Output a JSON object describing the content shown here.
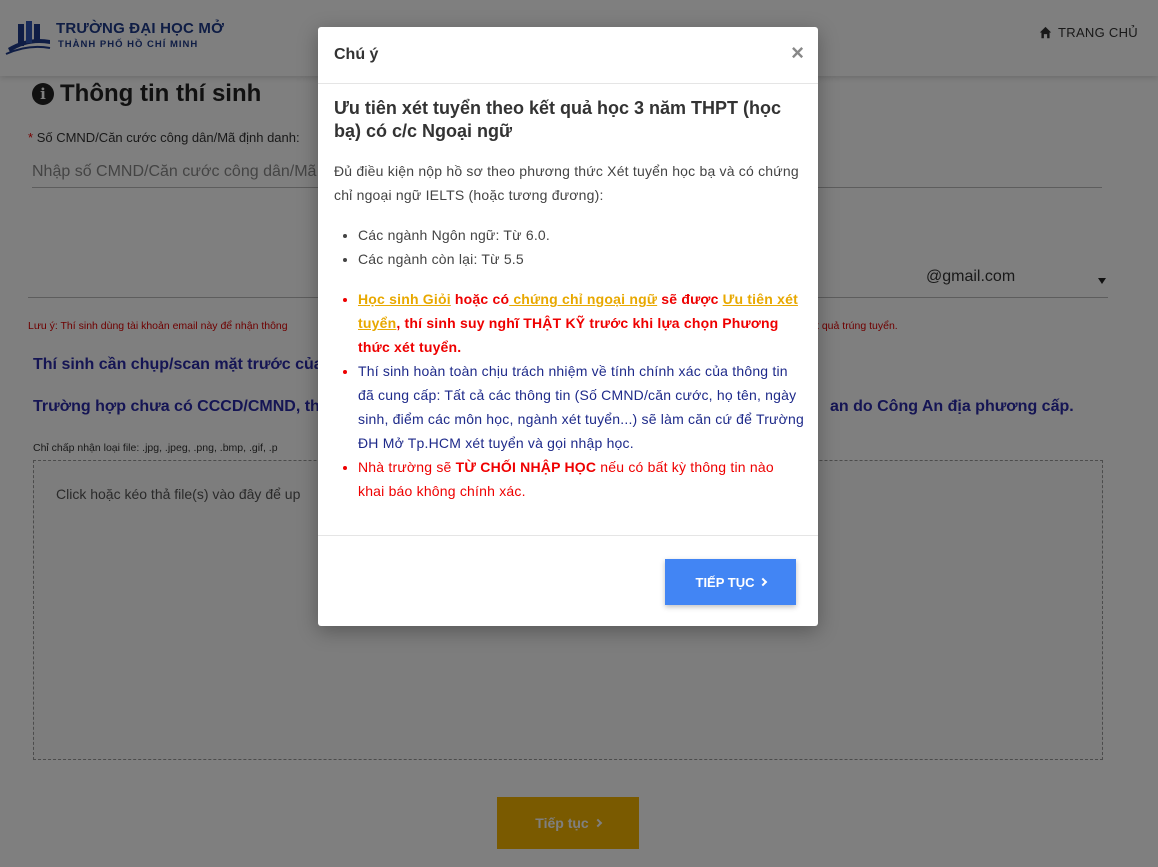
{
  "header": {
    "logo_title": "TRƯỜNG ĐẠI HỌC MỞ",
    "logo_subtitle": "THÀNH PHỐ HỒ CHÍ MINH",
    "home_label": "TRANG CHỦ"
  },
  "form": {
    "section_title": "Thông tin thí sinh",
    "id_label_required": "*",
    "id_label": "Số CMND/Căn cước công dân/Mã định danh:",
    "id_placeholder": "Nhập số CMND/Căn cước công dân/Mã định danh",
    "email_suffix": "@gmail.com",
    "email_note_start": "Lưu ý: Thí sinh dùng tài khoản email này để nhận thông",
    "email_note_end": "t quả trúng tuyển.",
    "scan_instruction": "Thí sinh cần chụp/scan mặt trước của",
    "no_id_instruction": "Trường hợp chưa có CCCD/CMND, thí",
    "no_id_instruction_end": "an do Công An địa phương cấp.",
    "file_types_note": "Chỉ chấp nhận loại file: .jpg, .jpeg, .png, .bmp, .gif, .p",
    "dropzone_text": "Click hoặc kéo thả file(s) vào đây để up",
    "continue_label": "Tiếp tục"
  },
  "modal": {
    "title": "Chú ý",
    "close_symbol": "×",
    "heading": "Ưu tiên xét tuyển theo kết quả học 3 năm THPT (học bạ) có c/c Ngoại ngữ",
    "intro": "Đủ điều kiện nộp hồ sơ theo phương thức Xét tuyển học bạ và có chứng chỉ ngoại ngữ IELTS (hoặc tương đương):",
    "scores": [
      "Các ngành Ngôn ngữ: Từ 6.0.",
      "Các ngành còn lại: Từ 5.5"
    ],
    "notice1": {
      "hl1": "Học sinh Giỏi",
      "t1": " hoặc có",
      "hl2": " chứng chỉ ngoại ngữ",
      "t2": " sẽ được ",
      "hl3": "Ưu tiên xét tuyển",
      "t3": ", thí sinh suy nghĩ THẬT KỸ trước khi lựa chọn Phương thức xét tuyển."
    },
    "notice2": "Thí sinh hoàn toàn chịu trách nhiệm về tính chính xác của thông tin đã cung cấp: Tất cả các thông tin (Số CMND/căn cước, họ tên, ngày sinh, điểm các môn học, ngành xét tuyển...) sẽ làm căn cứ để Trường ĐH Mở Tp.HCM xét tuyển và gọi nhập học.",
    "notice3": {
      "t1": "Nhà trường sẽ ",
      "b": "TỪ CHỐI NHẬP HỌC",
      "t2": " nếu có bất kỳ thông tin nào khai báo không chính xác."
    },
    "continue_label": "TIẾP TỤC"
  },
  "colors": {
    "brand_blue": "#1e3a8a",
    "modal_button": "#4285f4",
    "page_button": "#f5b400",
    "warning_red": "#e00000",
    "highlight_yellow": "#e8a800"
  }
}
